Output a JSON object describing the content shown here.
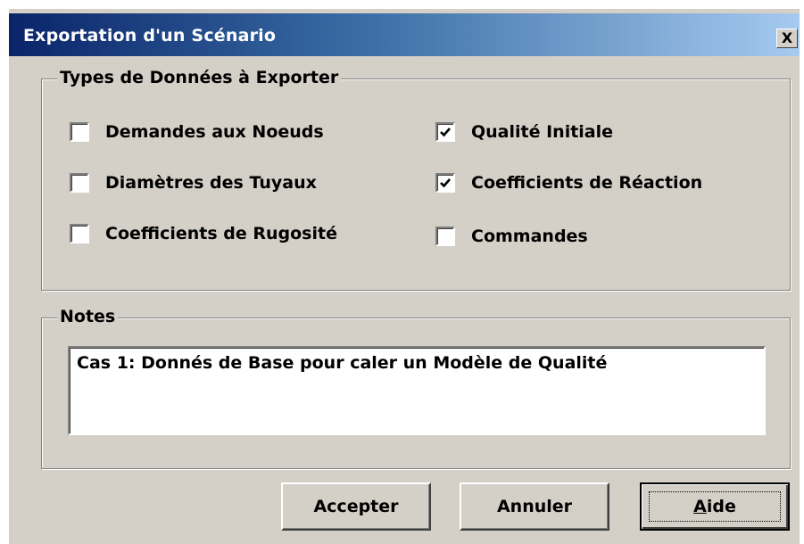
{
  "window": {
    "title": "Exportation d'un Scénario",
    "close_label": "X"
  },
  "types_group": {
    "title": "Types de Données à Exporter",
    "options": [
      {
        "label": "Demandes aux Noeuds",
        "checked": false
      },
      {
        "label": "Diamètres des Tuyaux",
        "checked": false
      },
      {
        "label": "Coefficients de Rugosité",
        "checked": false
      },
      {
        "label": "Qualité Initiale",
        "checked": true
      },
      {
        "label": "Coefficients de Réaction",
        "checked": true
      },
      {
        "label": "Commandes",
        "checked": false
      }
    ]
  },
  "notes_group": {
    "title": "Notes",
    "value": "Cas 1: Donnés de Base pour caler un Modèle de Qualité"
  },
  "buttons": {
    "accept": "Accepter",
    "cancel": "Annuler",
    "help": "Aide"
  },
  "colors": {
    "titlebar_start": "#0a246a",
    "titlebar_end": "#a6caf0",
    "face": "#d4d0c8"
  }
}
